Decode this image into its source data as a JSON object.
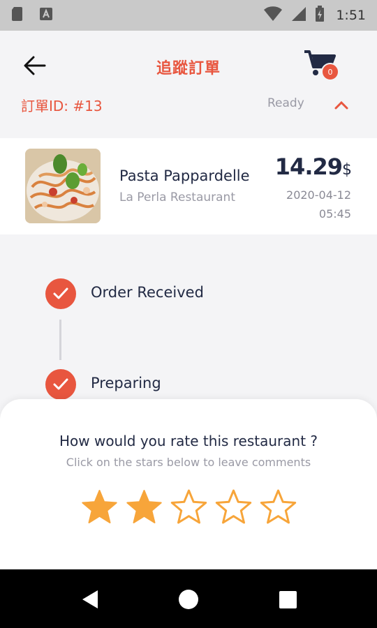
{
  "status_bar": {
    "time": "1:51",
    "icons": [
      "sd-card-icon",
      "text-a-icon",
      "wifi-icon",
      "signal-icon",
      "battery-charging-icon"
    ]
  },
  "header": {
    "title": "追蹤訂單",
    "cart_count": "0"
  },
  "order": {
    "id_label": "訂單ID: #13",
    "status": "Ready"
  },
  "item": {
    "name": "Pasta Pappardelle",
    "restaurant": "La Perla Restaurant",
    "price": "14.29",
    "currency": "$",
    "date": "2020-04-12",
    "time": "05:45"
  },
  "timeline": {
    "steps": [
      {
        "label": "Order Received"
      },
      {
        "label": "Preparing"
      }
    ]
  },
  "rating": {
    "title": "How would you rate this restaurant ?",
    "subtitle": "Click on the stars below to leave comments",
    "value": 2,
    "max": 5
  },
  "colors": {
    "accent": "#e8563f",
    "star": "#f7a53a",
    "text_dark": "#222a44",
    "text_muted": "#9a9aa5"
  }
}
